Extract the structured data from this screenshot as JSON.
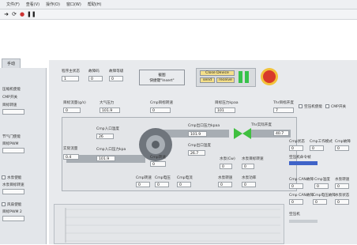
{
  "menubar": {
    "items": [
      "文件(F)",
      "查看(V)",
      "操作(O)",
      "窗口(W)",
      "帮助(H)"
    ]
  },
  "toolbar": {
    "icons": [
      "arrow-right-icon",
      "refresh-icon",
      "stop-icon",
      "pause-icon"
    ]
  },
  "tab": {
    "label": "手动"
  },
  "left_panel": {
    "items": [
      "压缩机使能",
      "CMP开关",
      "目标转速",
      "节气门使能",
      "目标PWM",
      "水泵使能",
      "水泵目标转速",
      "风扇使能",
      "目标PWM 2"
    ]
  },
  "header": {
    "prog_status_label": "程序主状态",
    "prog_status_value": "1",
    "fault_code_label": "故障码",
    "fault_code_value": "0",
    "fault_level_label": "故障等级",
    "fault_level_value": "0",
    "screenshot_label": "截图",
    "screenshot_hint": "快捷键\"Insert\"",
    "close_device_label": "Close Device",
    "send_label": "send",
    "receive_label": "receive"
  },
  "diagram": {
    "target_flow_label": "目标流量(g/s)",
    "target_flow_value": "0",
    "atm_pressure_label": "大气压力",
    "atm_pressure_value": "101.9",
    "cmp_target_speed_label": "Cmp目标转速",
    "cmp_target_speed_value": "0",
    "target_pressure_label": "目标压力kpaa",
    "target_pressure_value": "101",
    "thr_target_pos_label": "Thr目标开度",
    "thr_target_pos_value": "7",
    "cmp_inlet_temp_label": "Cmp入口温度",
    "cmp_inlet_temp_value": "26",
    "cmp_outlet_pressure_label": "Cmp出口压力kpaa",
    "cmp_outlet_pressure_value": "101.9",
    "thr_actual_pos_label": "Thr实际开度",
    "thr_actual_pos_value": "40.7",
    "actual_flow_label": "实际流量",
    "actual_flow_value": "0.4",
    "cmp_inlet_pressure_label": "Cmp入口压力kpa",
    "cmp_inlet_pressure_value": "101.9",
    "cmp_speed_label": "Cmp转速",
    "cmp_speed_value": "0",
    "cmp_outlet_temp_label": "Cmp出口温度",
    "cmp_outlet_temp_value": "26.7",
    "pump_speed_label": "水泵(Cw)",
    "pump_speed_value": "0",
    "pump_target_label": "水泵目标转速",
    "pump_target_value": "0",
    "cmp_voltage_label": "Cmp电压",
    "cmp_voltage_value": "0",
    "cmp_current_label": "Cmp电流",
    "cmp_current_value": "0",
    "pump_speed2_label": "水泵转速",
    "pump_speed2_value": "0",
    "pump_power_label": "水泵功率",
    "pump_power_value": "0",
    "cmp_temp_label": "Cmp转速",
    "cmp_temp_value": "0"
  },
  "right_panel": {
    "cmp_enable_label": "空压机使能",
    "cmp_switch_label": "CMP开关",
    "cmp_state_label": "Cmp状态",
    "cmp_state_value": "0",
    "cmp_mode_label": "Cmp工作模式",
    "cmp_mode_value": "0",
    "cmp_fault_label": "Cmp故障",
    "cmp_fault_value": "0",
    "cmp_enable2_label": "空压机命令帧",
    "cmp_can_fault_label": "Cmp CAN故障",
    "cmp_can_fault_value": "0",
    "cmp_temp2_label": "Cmp温度",
    "cmp_temp2_value": "0",
    "pump_label": "水泵转速",
    "pump_value": "0",
    "cmp_can_fault2_label": "Cmp CAN故障",
    "cmp_can_fault2_value": "0",
    "cmp_overload_label": "Cmp电压故障",
    "cmp_overload_value": "0",
    "pump_state_label": "水泵状态",
    "pump_state_value": "0",
    "cmp_machine_label": "空压机"
  },
  "colors": {
    "run_green": "#37c24a",
    "alarm_red": "#d83a2a",
    "alarm_yellow": "#f2c23a",
    "button_yellow": "#f4df8a",
    "thr_green": "#3fbf3f",
    "indicator_blue": "#3f63c8"
  }
}
